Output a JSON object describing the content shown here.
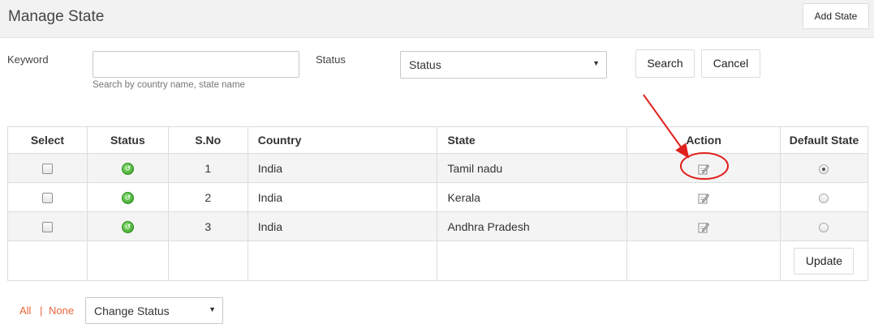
{
  "header": {
    "title": "Manage State",
    "add_button": "Add State"
  },
  "filters": {
    "keyword_label": "Keyword",
    "keyword_value": "",
    "keyword_hint": "Search by country name, state name",
    "status_label": "Status",
    "status_selected": "Status",
    "search_button": "Search",
    "cancel_button": "Cancel"
  },
  "table": {
    "columns": [
      "Select",
      "Status",
      "S.No",
      "Country",
      "State",
      "Action",
      "Default State"
    ],
    "rows": [
      {
        "sno": "1",
        "country": "India",
        "state": "Tamil nadu",
        "default": true
      },
      {
        "sno": "2",
        "country": "India",
        "state": "Kerala",
        "default": false
      },
      {
        "sno": "3",
        "country": "India",
        "state": "Andhra Pradesh",
        "default": false
      }
    ],
    "update_button": "Update"
  },
  "bulk": {
    "all_link": "All",
    "separator": "|",
    "none_link": "None",
    "change_status_selected": "Change Status"
  },
  "colors": {
    "link": "#e8643a",
    "annotation": "#e0201c",
    "status_active": "#2e9b1e"
  }
}
